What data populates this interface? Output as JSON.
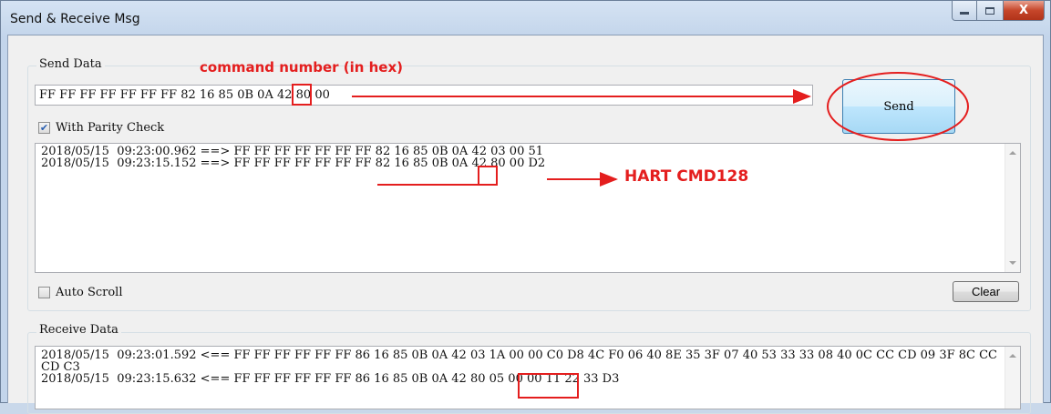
{
  "window": {
    "title": "Send & Receive Msg",
    "close_glyph": "X"
  },
  "send_group": {
    "label": "Send Data",
    "input_value": "FF FF FF FF FF FF FF 82 16 85 0B 0A 42 80 00",
    "send_label": "Send",
    "parity_label": "With Parity Check",
    "parity_checked": true
  },
  "send_log": {
    "lines": [
      "2018/05/15  09:23:00.962 ==> FF FF FF FF FF FF FF 82 16 85 0B 0A 42 03 00 51",
      "2018/05/15  09:23:15.152 ==> FF FF FF FF FF FF FF 82 16 85 0B 0A 42 80 00 D2"
    ]
  },
  "auto_scroll": {
    "label": "Auto Scroll",
    "checked": false
  },
  "clear_label": "Clear",
  "receive_group": {
    "label": "Receive Data",
    "lines": [
      "2018/05/15  09:23:01.592 <== FF FF FF FF FF FF 86 16 85 0B 0A 42 03 1A 00 00 C0 D8 4C F0 06 40 8E 35 3F 07 40 53 33 33 08 40 0C CC CD 09 3F 8C CC",
      "CD C3",
      "2018/05/15  09:23:15.632 <== FF FF FF FF FF FF 86 16 85 0B 0A 42 80 05 00 00 11 22 33 D3"
    ]
  },
  "annotations": {
    "command_number": "command number (in hex)",
    "hart_cmd": "HART CMD128"
  },
  "colors": {
    "annotation_red": "#e41e1e",
    "accent_blue": "#3c7fb1"
  },
  "icons": {
    "minimize": "minimize-icon",
    "maximize": "maximize-icon",
    "close": "close-icon",
    "checkmark": "checkmark-icon",
    "scroll_up": "scroll-up-icon",
    "scroll_down": "scroll-down-icon"
  }
}
